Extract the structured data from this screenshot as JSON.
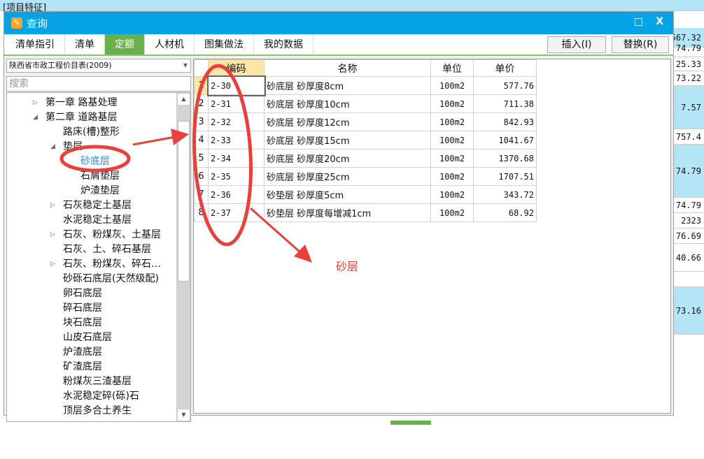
{
  "background": {
    "top_label": "[项目特征]",
    "right_values": [
      "567.32",
      "74.79",
      "25.33",
      "73.22",
      "7.57",
      "757.4",
      "74.79",
      "74.79",
      "2323",
      "76.69",
      "40.66",
      "73.16"
    ]
  },
  "dialog": {
    "title": "查询",
    "maximize_icon": "□",
    "close_icon": "X",
    "tabs": [
      "清单指引",
      "清单",
      "定额",
      "人材机",
      "图集做法",
      "我的数据"
    ],
    "active_tab": "定额",
    "insert_label": "插入(I)",
    "replace_label": "替换(R)",
    "library": "陕西省市政工程价目表(2009)",
    "search_placeholder": "搜索",
    "tree": [
      {
        "label": "第一章  路基处理",
        "level": 0,
        "toggle": "collapsed"
      },
      {
        "label": "第二章  道路基层",
        "level": 0,
        "toggle": "expanded"
      },
      {
        "label": "路床(槽)整形",
        "level": 1
      },
      {
        "label": "垫层",
        "level": 1,
        "toggle": "expanded"
      },
      {
        "label": "砂底层",
        "level": 2,
        "selected": true
      },
      {
        "label": "石屑垫层",
        "level": 2
      },
      {
        "label": "炉渣垫层",
        "level": 2
      },
      {
        "label": "石灰稳定土基层",
        "level": 1,
        "toggle": "collapsed"
      },
      {
        "label": "水泥稳定土基层",
        "level": 1
      },
      {
        "label": "石灰、粉煤灰、土基层",
        "level": 1,
        "toggle": "collapsed"
      },
      {
        "label": "石灰、土、碎石基层",
        "level": 1
      },
      {
        "label": "石灰、粉煤灰、碎石…",
        "level": 1,
        "toggle": "collapsed"
      },
      {
        "label": "砂砾石底层(天然级配)",
        "level": 1
      },
      {
        "label": "卵石底层",
        "level": 1
      },
      {
        "label": "碎石底层",
        "level": 1
      },
      {
        "label": "块石底层",
        "level": 1
      },
      {
        "label": "山皮石底层",
        "level": 1
      },
      {
        "label": "炉渣底层",
        "level": 1
      },
      {
        "label": "矿渣底层",
        "level": 1
      },
      {
        "label": "粉煤灰三渣基层",
        "level": 1
      },
      {
        "label": "水泥稳定碎(砾)石",
        "level": 1
      },
      {
        "label": "顶层多合土养生",
        "level": 1
      }
    ],
    "table": {
      "headers": [
        "编码",
        "名称",
        "单位",
        "单价"
      ],
      "rows": [
        [
          "1",
          "2-30",
          "砂底层  砂厚度8cm",
          "100m2",
          "577.76"
        ],
        [
          "2",
          "2-31",
          "砂底层  砂厚度10cm",
          "100m2",
          "711.38"
        ],
        [
          "3",
          "2-32",
          "砂底层  砂厚度12cm",
          "100m2",
          "842.93"
        ],
        [
          "4",
          "2-33",
          "砂底层  砂厚度15cm",
          "100m2",
          "1041.67"
        ],
        [
          "5",
          "2-34",
          "砂底层  砂厚度20cm",
          "100m2",
          "1370.68"
        ],
        [
          "6",
          "2-35",
          "砂底层  砂厚度25cm",
          "100m2",
          "1707.51"
        ],
        [
          "7",
          "2-36",
          "砂垫层  砂厚度5cm",
          "100m2",
          "343.72"
        ],
        [
          "8",
          "2-37",
          "砂垫层  砂厚度每增减1cm",
          "100m2",
          "68.92"
        ]
      ]
    }
  },
  "annotation": {
    "text": "砂层",
    "color": "#e8403b"
  },
  "colors": {
    "titlebar": "#06a3e6",
    "active_tab": "#6ab04c",
    "selected_node": "#2b8ad8"
  }
}
